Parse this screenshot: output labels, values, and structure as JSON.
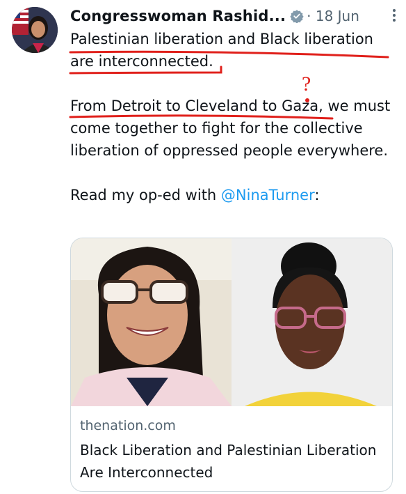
{
  "author": {
    "display_name": "Congresswoman Rashid...",
    "date": "· 18 Jun"
  },
  "tweet": {
    "paragraph1": "Palestinian liberation and Black liberation are interconnected.",
    "paragraph2": "From Detroit to Cleveland to Gaza, we must come together to fight for the collective liberation of oppressed people everywhere.",
    "paragraph3_prefix": "Read my op-ed with ",
    "mention": "@NinaTurner",
    "paragraph3_suffix": ":"
  },
  "link_card": {
    "domain": "thenation.com",
    "title": "Black Liberation and Palestinian Liberation Are Interconnected"
  },
  "annotation": {
    "question_mark": "?"
  },
  "colors": {
    "link": "#1d9bf0",
    "muted": "#536471",
    "ink_red": "#e0201b"
  }
}
